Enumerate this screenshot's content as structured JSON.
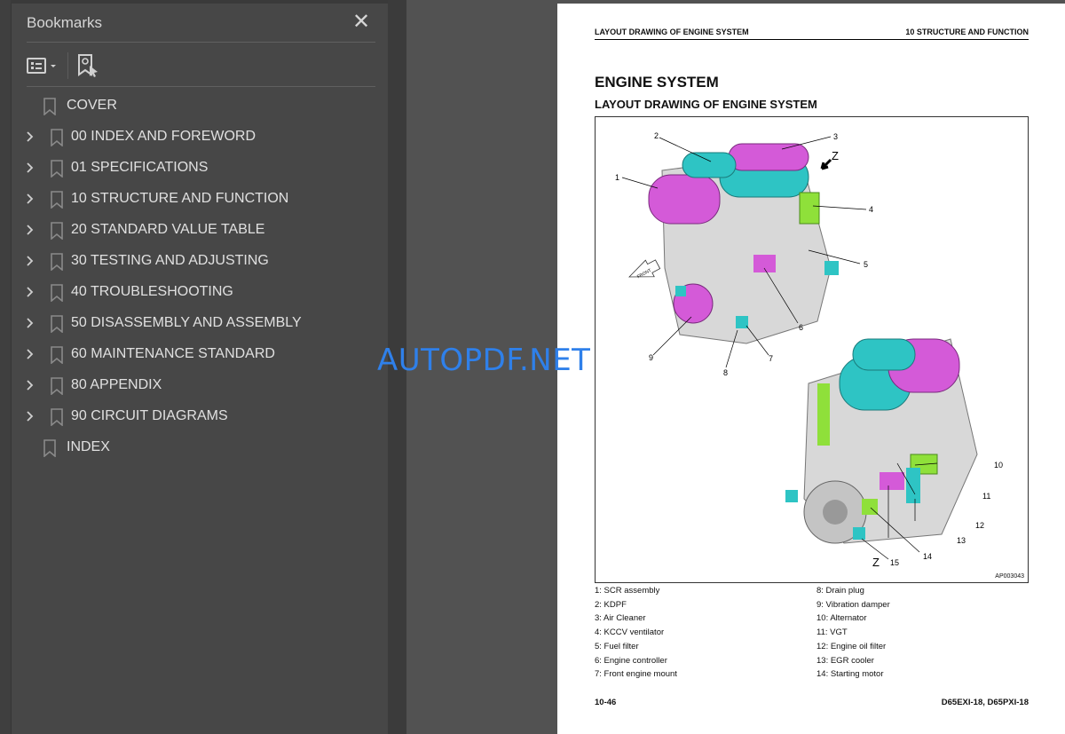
{
  "sidebar": {
    "title": "Bookmarks",
    "close_icon": "close-icon",
    "toolbar": {
      "options_icon": "list-options-icon",
      "find_icon": "find-current-bookmark-icon"
    },
    "items": [
      {
        "label": "COVER",
        "expandable": false
      },
      {
        "label": "00 INDEX AND FOREWORD",
        "expandable": true
      },
      {
        "label": "01 SPECIFICATIONS",
        "expandable": true
      },
      {
        "label": "10 STRUCTURE AND FUNCTION",
        "expandable": true
      },
      {
        "label": "20 STANDARD VALUE TABLE",
        "expandable": true
      },
      {
        "label": "30 TESTING AND ADJUSTING",
        "expandable": true
      },
      {
        "label": "40 TROUBLESHOOTING",
        "expandable": true
      },
      {
        "label": "50 DISASSEMBLY AND ASSEMBLY",
        "expandable": true
      },
      {
        "label": "60 MAINTENANCE STANDARD",
        "expandable": true
      },
      {
        "label": "80 APPENDIX",
        "expandable": true
      },
      {
        "label": "90 CIRCUIT DIAGRAMS",
        "expandable": true
      },
      {
        "label": "INDEX",
        "expandable": false
      }
    ]
  },
  "watermark": "AUTOPDF.NET",
  "page": {
    "header_left": "LAYOUT DRAWING OF ENGINE SYSTEM",
    "header_right": "10 STRUCTURE AND FUNCTION",
    "title": "ENGINE SYSTEM",
    "subtitle": "LAYOUT DRAWING OF ENGINE SYSTEM",
    "figure_id": "AP003043",
    "view_label": "Z",
    "callouts": [
      "1",
      "2",
      "3",
      "4",
      "5",
      "6",
      "7",
      "8",
      "9",
      "10",
      "11",
      "12",
      "13",
      "14",
      "15"
    ],
    "front_label": "FRONT",
    "captions_left": [
      "1: SCR assembly",
      "2: KDPF",
      "3: Air Cleaner",
      "4: KCCV ventilator",
      "5: Fuel filter",
      "6: Engine controller",
      "7: Front engine mount"
    ],
    "captions_right": [
      "8: Drain plug",
      "9: Vibration damper",
      "10: Alternator",
      "11: VGT",
      "12: Engine oil filter",
      "13: EGR cooler",
      "14: Starting motor"
    ],
    "footer_left": "10-46",
    "footer_right": "D65EXI-18, D65PXI-18"
  },
  "colors": {
    "accent_watermark": "#2f80ea",
    "part_magenta": "#d45ad8",
    "part_cyan": "#2ec4c4",
    "part_green": "#8fe03a"
  }
}
